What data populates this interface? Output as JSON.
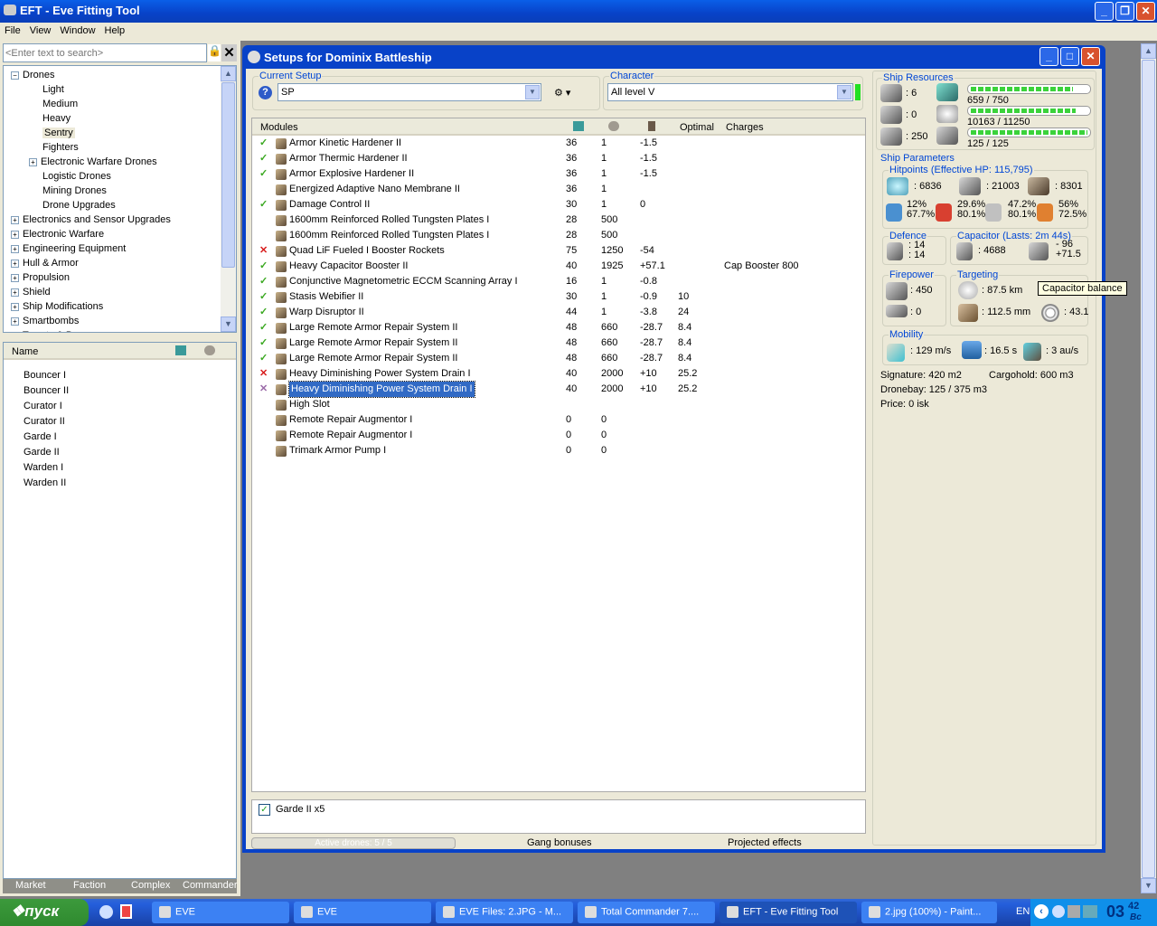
{
  "app": {
    "title": "EFT - Eve Fitting Tool",
    "menu": [
      "File",
      "View",
      "Window",
      "Help"
    ]
  },
  "left": {
    "search_placeholder": "<Enter text to search>",
    "tree": [
      {
        "label": "Drones",
        "level": 0,
        "expander": "minus"
      },
      {
        "label": "Light",
        "level": 1
      },
      {
        "label": "Medium",
        "level": 1
      },
      {
        "label": "Heavy",
        "level": 1
      },
      {
        "label": "Sentry",
        "level": 1,
        "selected": true
      },
      {
        "label": "Fighters",
        "level": 1
      },
      {
        "label": "Electronic Warfare Drones",
        "level": 1,
        "expander": "plus"
      },
      {
        "label": "Logistic Drones",
        "level": 1
      },
      {
        "label": "Mining Drones",
        "level": 1
      },
      {
        "label": "Drone Upgrades",
        "level": 1
      },
      {
        "label": "Electronics and Sensor Upgrades",
        "level": 0,
        "expander": "plus"
      },
      {
        "label": "Electronic Warfare",
        "level": 0,
        "expander": "plus"
      },
      {
        "label": "Engineering Equipment",
        "level": 0,
        "expander": "plus"
      },
      {
        "label": "Hull & Armor",
        "level": 0,
        "expander": "plus"
      },
      {
        "label": "Propulsion",
        "level": 0,
        "expander": "plus"
      },
      {
        "label": "Shield",
        "level": 0,
        "expander": "plus"
      },
      {
        "label": "Ship Modifications",
        "level": 0,
        "expander": "plus"
      },
      {
        "label": "Smartbombs",
        "level": 0,
        "expander": "plus"
      },
      {
        "label": "Turrets & Bays",
        "level": 0,
        "expander": "plus"
      }
    ],
    "list_header": "Name",
    "items": [
      "Bouncer I",
      "Bouncer II",
      "Curator I",
      "Curator II",
      "Garde I",
      "Garde II",
      "Warden I",
      "Warden II"
    ],
    "tabs": [
      "Market",
      "Faction",
      "Complex",
      "Commander"
    ]
  },
  "setup": {
    "title": "Setups for Dominix Battleship",
    "current_setup_label": "Current Setup",
    "current_setup": "SP",
    "character_label": "Character",
    "character": "All level V",
    "columns": {
      "modules": "Modules",
      "optimal": "Optimal",
      "charges": "Charges"
    },
    "modules": [
      {
        "status": "ok",
        "name": "Armor Kinetic Hardener II",
        "cpu": "36",
        "pg": "1",
        "cap": "-1.5",
        "optimal": "",
        "charges": ""
      },
      {
        "status": "ok",
        "name": "Armor Thermic Hardener II",
        "cpu": "36",
        "pg": "1",
        "cap": "-1.5",
        "optimal": "",
        "charges": ""
      },
      {
        "status": "ok",
        "name": "Armor Explosive Hardener II",
        "cpu": "36",
        "pg": "1",
        "cap": "-1.5",
        "optimal": "",
        "charges": ""
      },
      {
        "status": "",
        "name": "Energized Adaptive Nano Membrane II",
        "cpu": "36",
        "pg": "1",
        "cap": "",
        "optimal": "",
        "charges": ""
      },
      {
        "status": "ok",
        "name": "Damage Control II",
        "cpu": "30",
        "pg": "1",
        "cap": "0",
        "optimal": "",
        "charges": ""
      },
      {
        "status": "",
        "name": "1600mm Reinforced Rolled Tungsten Plates I",
        "cpu": "28",
        "pg": "500",
        "cap": "",
        "optimal": "",
        "charges": ""
      },
      {
        "status": "",
        "name": "1600mm Reinforced Rolled Tungsten Plates I",
        "cpu": "28",
        "pg": "500",
        "cap": "",
        "optimal": "",
        "charges": ""
      },
      {
        "status": "x",
        "name": "Quad LiF Fueled I Booster Rockets",
        "cpu": "75",
        "pg": "1250",
        "cap": "-54",
        "optimal": "",
        "charges": ""
      },
      {
        "status": "ok",
        "name": "Heavy Capacitor Booster II",
        "cpu": "40",
        "pg": "1925",
        "cap": "+57.1",
        "optimal": "",
        "charges": "Cap Booster 800"
      },
      {
        "status": "ok",
        "name": "Conjunctive Magnetometric ECCM Scanning Array I",
        "cpu": "16",
        "pg": "1",
        "cap": "-0.8",
        "optimal": "",
        "charges": ""
      },
      {
        "status": "ok",
        "name": "Stasis Webifier II",
        "cpu": "30",
        "pg": "1",
        "cap": "-0.9",
        "optimal": "10",
        "charges": ""
      },
      {
        "status": "ok",
        "name": "Warp Disruptor II",
        "cpu": "44",
        "pg": "1",
        "cap": "-3.8",
        "optimal": "24",
        "charges": ""
      },
      {
        "status": "ok",
        "name": "Large Remote Armor Repair System II",
        "cpu": "48",
        "pg": "660",
        "cap": "-28.7",
        "optimal": "8.4",
        "charges": ""
      },
      {
        "status": "ok",
        "name": "Large Remote Armor Repair System II",
        "cpu": "48",
        "pg": "660",
        "cap": "-28.7",
        "optimal": "8.4",
        "charges": ""
      },
      {
        "status": "ok",
        "name": "Large Remote Armor Repair System II",
        "cpu": "48",
        "pg": "660",
        "cap": "-28.7",
        "optimal": "8.4",
        "charges": ""
      },
      {
        "status": "x",
        "name": "Heavy Diminishing Power System Drain I",
        "cpu": "40",
        "pg": "2000",
        "cap": "+10",
        "optimal": "25.2",
        "charges": ""
      },
      {
        "status": "p",
        "name": "Heavy Diminishing Power System Drain I",
        "cpu": "40",
        "pg": "2000",
        "cap": "+10",
        "optimal": "25.2",
        "charges": "",
        "selected": true
      },
      {
        "status": "",
        "name": "High Slot",
        "cpu": "",
        "pg": "",
        "cap": "",
        "optimal": "",
        "charges": ""
      },
      {
        "status": "",
        "name": "Remote Repair Augmentor I",
        "cpu": "0",
        "pg": "0",
        "cap": "",
        "optimal": "",
        "charges": ""
      },
      {
        "status": "",
        "name": "Remote Repair Augmentor I",
        "cpu": "0",
        "pg": "0",
        "cap": "",
        "optimal": "",
        "charges": ""
      },
      {
        "status": "",
        "name": "Trimark Armor Pump I",
        "cpu": "0",
        "pg": "0",
        "cap": "",
        "optimal": "",
        "charges": ""
      }
    ],
    "drone": {
      "label": "Garde II x5",
      "checked": true
    },
    "active_drones": "Active drones: 5 / 5",
    "active_drones_fraction": 1,
    "gang_bonuses": "Gang bonuses",
    "projected_effects": "Projected effects"
  },
  "resources": {
    "label": "Ship Resources",
    "turrets": ": 6",
    "launchers": ": 0",
    "drone_bandwidth": ": 250",
    "cpu": "659 / 750",
    "cpu_fraction": 0.879,
    "powergrid": "10163 / 11250",
    "powergrid_fraction": 0.903,
    "dronebay_bw": "125 / 125",
    "dronebay_bw_fraction": 1
  },
  "params": {
    "label": "Ship Parameters",
    "hitpoints_label": "Hitpoints (Effective HP: 115,795)",
    "shield": ": 6836",
    "armor": ": 21003",
    "structure": ": 8301",
    "resists": [
      [
        "12%",
        "67.7%"
      ],
      [
        "29.6%",
        "80.1%"
      ],
      [
        "47.2%",
        "80.1%"
      ],
      [
        "56%",
        "72.5%"
      ]
    ],
    "defence_label": "Defence",
    "defence": [
      ": 14",
      ": 14"
    ],
    "capacitor_label": "Capacitor (Lasts: 2m 44s)",
    "capacitor": ": 4688",
    "cap_delta": [
      "- 96",
      "+71.5"
    ],
    "firepower_label": "Firepower",
    "firepower": [
      ": 450",
      ": 0"
    ],
    "targeting_label": "Targeting",
    "target_range": ": 87.5 km",
    "scan_res": ": 112.5 mm",
    "sensor_strength": ": 43.1",
    "tooltip": "Capacitor balance",
    "mobility_label": "Mobility",
    "velocity": ": 129 m/s",
    "align": ": 16.5 s",
    "warp": ": 3 au/s",
    "signature": "Signature: 420 m2",
    "cargohold": "Cargohold: 600 m3",
    "dronebay": "Dronebay: 125 / 375 m3",
    "price": "Price: 0 isk"
  },
  "taskbar": {
    "start": "пуск",
    "tasks": [
      "EVE",
      "EVE",
      "EVE Files: 2.JPG - M...",
      "Total Commander 7....",
      "EFT - Eve Fitting Tool",
      "2.jpg (100%) - Paint..."
    ],
    "active_task": 4,
    "lang": "EN",
    "clock": "03",
    "clock_min": "42",
    "clock_day": "Вс"
  }
}
